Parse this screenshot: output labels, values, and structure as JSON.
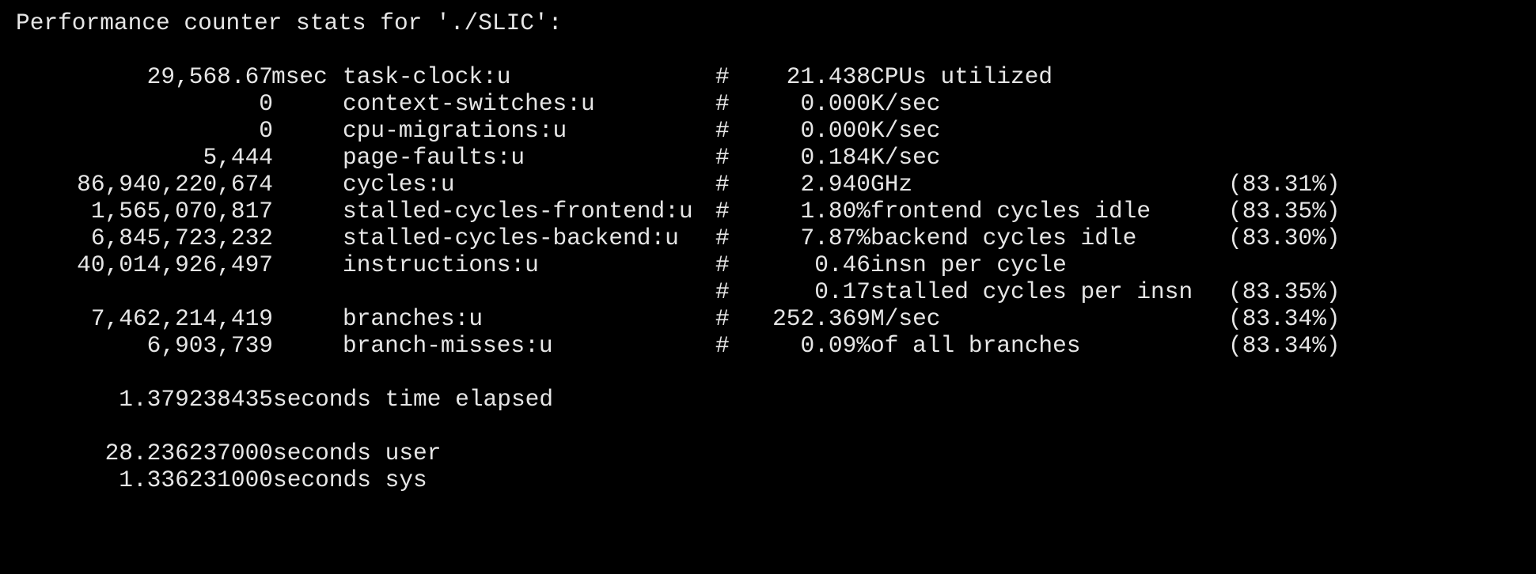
{
  "header": "Performance counter stats for './SLIC':",
  "counters": [
    {
      "count": "29,568.67",
      "unit": "msec",
      "event": "task-clock:u",
      "hash": "#",
      "value": "21.438",
      "desc": "CPUs utilized",
      "pct": ""
    },
    {
      "count": "0",
      "unit": "",
      "event": "context-switches:u",
      "hash": "#",
      "value": "0.000",
      "desc": "K/sec",
      "pct": ""
    },
    {
      "count": "0",
      "unit": "",
      "event": "cpu-migrations:u",
      "hash": "#",
      "value": "0.000",
      "desc": "K/sec",
      "pct": ""
    },
    {
      "count": "5,444",
      "unit": "",
      "event": "page-faults:u",
      "hash": "#",
      "value": "0.184",
      "desc": "K/sec",
      "pct": ""
    },
    {
      "count": "86,940,220,674",
      "unit": "",
      "event": "cycles:u",
      "hash": "#",
      "value": "2.940",
      "desc": "GHz",
      "pct": "(83.31%)"
    },
    {
      "count": "1,565,070,817",
      "unit": "",
      "event": "stalled-cycles-frontend:u",
      "hash": "#",
      "value": "1.80%",
      "desc": "frontend cycles idle",
      "pct": "(83.35%)"
    },
    {
      "count": "6,845,723,232",
      "unit": "",
      "event": "stalled-cycles-backend:u",
      "hash": "#",
      "value": "7.87%",
      "desc": "backend cycles idle",
      "pct": "(83.30%)"
    },
    {
      "count": "40,014,926,497",
      "unit": "",
      "event": "instructions:u",
      "hash": "#",
      "value": "0.46",
      "desc": "insn per cycle",
      "pct": ""
    },
    {
      "count": "",
      "unit": "",
      "event": "",
      "hash": "#",
      "value": "0.17",
      "desc": "stalled cycles per insn",
      "pct": "(83.35%)"
    },
    {
      "count": "7,462,214,419",
      "unit": "",
      "event": "branches:u",
      "hash": "#",
      "value": "252.369",
      "desc": "M/sec",
      "pct": "(83.34%)"
    },
    {
      "count": "6,903,739",
      "unit": "",
      "event": "branch-misses:u",
      "hash": "#",
      "value": "0.09%",
      "desc": "of all branches",
      "pct": "(83.34%)"
    }
  ],
  "elapsed": {
    "value": "1.379238435",
    "label": "seconds time elapsed"
  },
  "user": {
    "value": "28.236237000",
    "label": "seconds user"
  },
  "sys": {
    "value": "1.336231000",
    "label": "seconds sys"
  },
  "colors": {
    "background": "#000000",
    "text": "#e6e6e6"
  }
}
